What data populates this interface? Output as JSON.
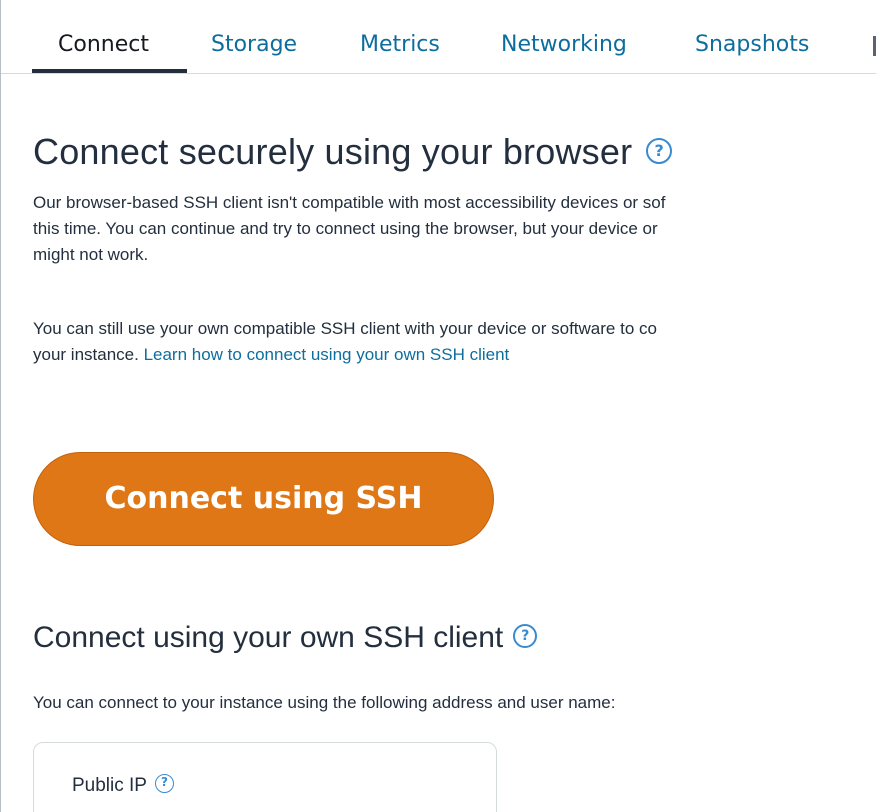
{
  "tabs": [
    {
      "label": "Connect",
      "active": true
    },
    {
      "label": "Storage",
      "active": false
    },
    {
      "label": "Metrics",
      "active": false
    },
    {
      "label": "Networking",
      "active": false
    },
    {
      "label": "Snapshots",
      "active": false
    }
  ],
  "browser_section": {
    "title": "Connect securely using your browser",
    "help_glyph": "?",
    "paragraph1_line1": "Our browser-based SSH client isn't compatible with most accessibility devices or sof",
    "paragraph1_line2": "this time. You can continue and try to connect using the browser, but your device or",
    "paragraph1_line3": "might not work.",
    "paragraph2_line1": "You can still use your own compatible SSH client with your device or software to co",
    "paragraph2_line2_prefix": "your instance. ",
    "paragraph2_link": "Learn how to connect using your own SSH client"
  },
  "connect_button": {
    "label": "Connect using SSH",
    "color": "#e07716"
  },
  "own_client_section": {
    "title": "Connect using your own SSH client",
    "help_glyph": "?",
    "description": "You can connect to your instance using the following address and user name:",
    "public_ip_label": "Public IP"
  },
  "colors": {
    "link": "#0d6e9e",
    "help_icon": "#3a8ad1",
    "text": "#232f3e"
  },
  "icons": {
    "help": "question-circle-icon"
  }
}
